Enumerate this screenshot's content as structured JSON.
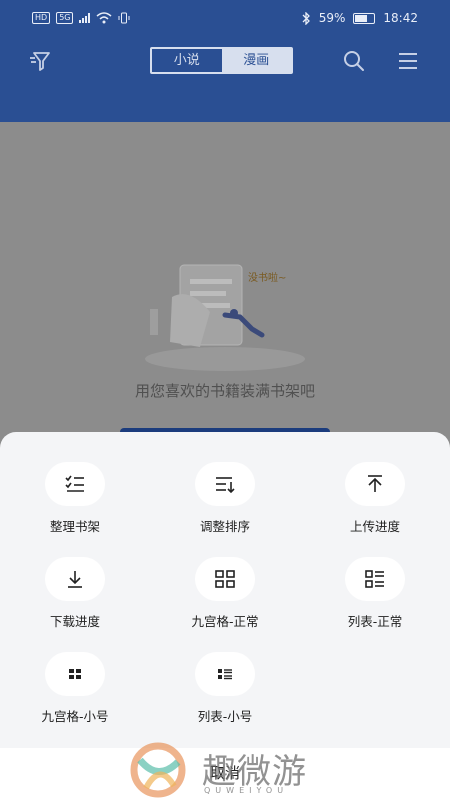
{
  "status_bar": {
    "left_badges": [
      "HD",
      "5G"
    ],
    "battery_percent": "59%",
    "time": "18:42"
  },
  "header": {
    "tabs": [
      {
        "label": "小说",
        "active": false
      },
      {
        "label": "漫画",
        "active": true
      }
    ],
    "icons": [
      "filter-icon",
      "search-icon",
      "menu-icon"
    ],
    "accent": "#2a4f93"
  },
  "empty_state": {
    "illustration_text": "没书啦~",
    "message": "用您喜欢的书籍装满书架吧"
  },
  "sheet": {
    "items": [
      {
        "label": "整理书架",
        "icon": "checklist-icon"
      },
      {
        "label": "调整排序",
        "icon": "sort-icon"
      },
      {
        "label": "上传进度",
        "icon": "upload-icon"
      },
      {
        "label": "下载进度",
        "icon": "download-icon"
      },
      {
        "label": "九宫格-正常",
        "icon": "grid-icon"
      },
      {
        "label": "列表-正常",
        "icon": "list-icon"
      },
      {
        "label": "九宫格-小号",
        "icon": "grid-small-icon"
      },
      {
        "label": "列表-小号",
        "icon": "list-small-icon"
      }
    ],
    "cancel_label": "取消"
  },
  "watermark": {
    "text": "趣微游",
    "sub": "QUWEIYOU"
  }
}
